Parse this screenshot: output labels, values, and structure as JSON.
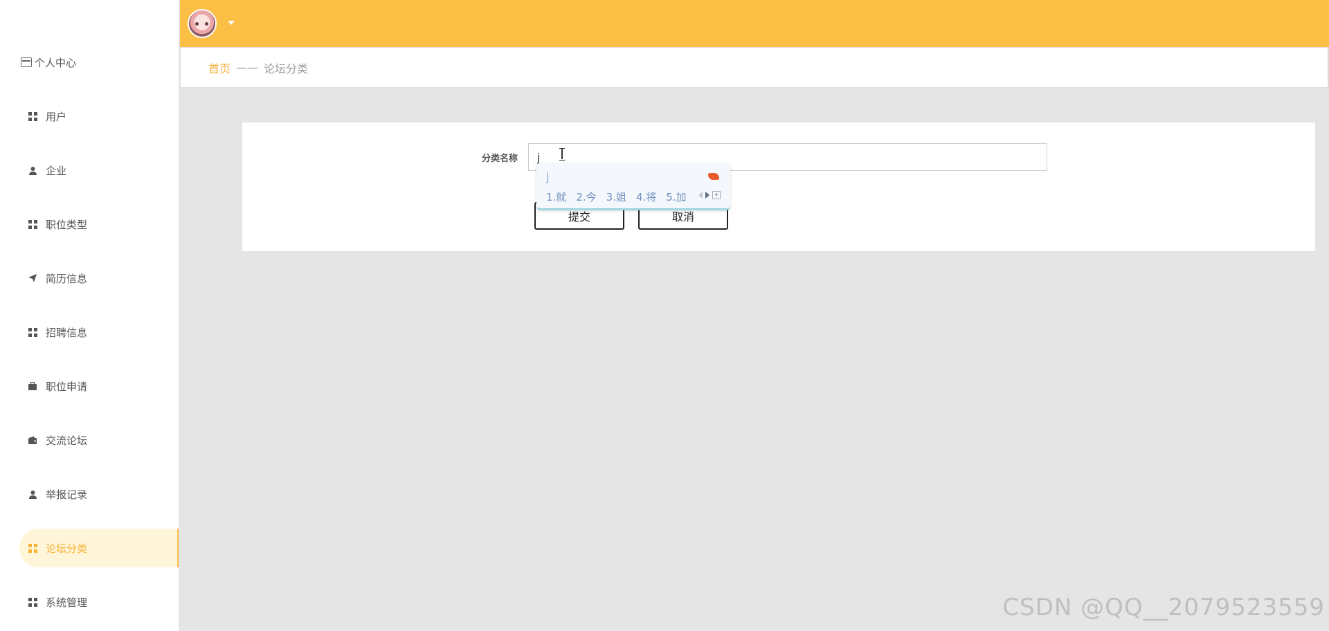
{
  "sidebar": {
    "personal_center": "个人中心",
    "items": [
      {
        "label": "用户",
        "icon": "grid-icon"
      },
      {
        "label": "企业",
        "icon": "person-icon"
      },
      {
        "label": "职位类型",
        "icon": "grid-icon"
      },
      {
        "label": "简历信息",
        "icon": "paper-plane-icon"
      },
      {
        "label": "招聘信息",
        "icon": "grid-icon"
      },
      {
        "label": "职位申请",
        "icon": "briefcase-icon"
      },
      {
        "label": "交流论坛",
        "icon": "wallet-icon"
      },
      {
        "label": "举报记录",
        "icon": "person-icon"
      },
      {
        "label": "论坛分类",
        "icon": "grid-icon",
        "active": true
      },
      {
        "label": "系统管理",
        "icon": "grid-icon"
      }
    ]
  },
  "colors": {
    "header": "#fcbf46",
    "accent": "#f9b234",
    "active_bg": "#fff5d9",
    "content_bg": "#e5e5e5"
  },
  "breadcrumb": {
    "home": "首页",
    "separator": "——",
    "current": "论坛分类"
  },
  "form": {
    "category_name_label": "分类名称",
    "category_name_value": "j",
    "submit_label": "提交",
    "cancel_label": "取消"
  },
  "ime": {
    "composition": "j",
    "candidates": [
      "1.就",
      "2.今",
      "3.姐",
      "4.将",
      "5.加"
    ]
  },
  "watermark": "CSDN @QQ__2079523559"
}
